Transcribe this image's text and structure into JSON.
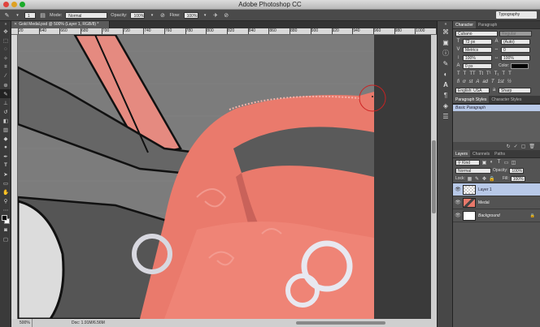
{
  "window": {
    "title": "Adobe Photoshop CC"
  },
  "options_bar": {
    "mode_label": "Mode:",
    "mode_value": "Normal",
    "opacity_label": "Opacity:",
    "opacity_value": "100%",
    "flow_label": "Flow:",
    "flow_value": "100%",
    "brush_size": "1",
    "workspace_value": "Typography"
  },
  "document": {
    "tab_title": "Gold Medal.psd @ 500% (Layer 1, RGB/8) *",
    "ruler_ticks": [
      "20",
      "640",
      "660",
      "680",
      "700",
      "720",
      "740",
      "760",
      "780",
      "800",
      "820",
      "840",
      "860",
      "880",
      "900",
      "920",
      "940",
      "960",
      "980",
      "1000",
      "1020",
      "1040"
    ],
    "zoom": "500%",
    "doc_info": "Doc: 1.91M/6.56M"
  },
  "character_panel": {
    "tabs": [
      "Character",
      "Paragraph"
    ],
    "font_family": "Cubano",
    "font_style": "Regular",
    "font_size": "72 px",
    "leading": "(Auto)",
    "kerning": "Metrics",
    "tracking": "0",
    "vertical_scale": "100%",
    "horizontal_scale": "100%",
    "baseline_shift": "0 px",
    "color_label": "Color:",
    "text_color": "#000000",
    "language": "English: USA",
    "anti_alias": "Sharp",
    "glyph_buttons": [
      "T",
      "T",
      "TT",
      "Tt",
      "T¹",
      "T₁",
      "T",
      "T"
    ],
    "opentype_buttons": [
      "fi",
      "ơ",
      "st",
      "A",
      "ad",
      "T",
      "1st",
      "½"
    ]
  },
  "styles_panel": {
    "tabs": [
      "Paragraph Styles",
      "Character Styles"
    ],
    "selected_style": "Basic Paragraph"
  },
  "layers_panel": {
    "tabs": [
      "Layers",
      "Channels",
      "Paths"
    ],
    "filter_label": "Kind",
    "blend_mode": "Normal",
    "opacity_label": "Opacity:",
    "opacity_value": "100%",
    "lock_label": "Lock:",
    "fill_label": "Fill:",
    "fill_value": "100%",
    "layers": [
      {
        "name": "Layer 1",
        "selected": true
      },
      {
        "name": "Medal",
        "selected": false
      },
      {
        "name": "Background",
        "selected": false
      }
    ]
  },
  "colors": {
    "selection": "#b8c9e8",
    "ribbon": "#e8786a",
    "panel_bg": "#535353"
  }
}
